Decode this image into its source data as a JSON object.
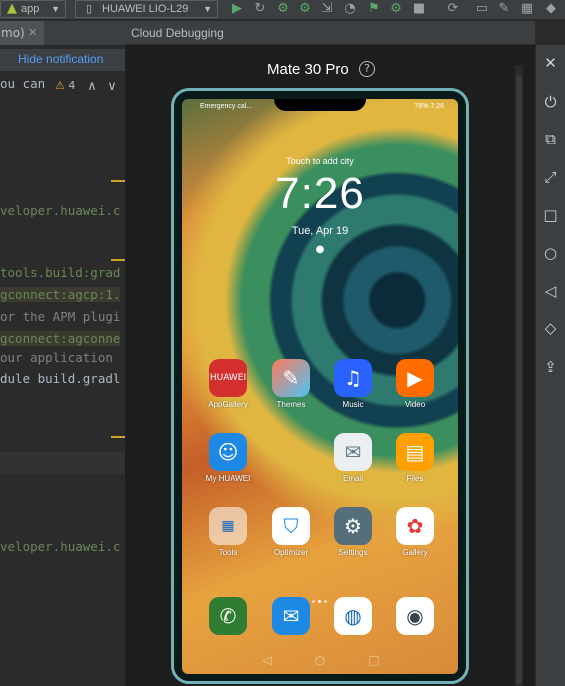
{
  "toolbar": {
    "run_config": "app",
    "device": "HUAWEI LIO-L29"
  },
  "editor": {
    "tab_label": "mo)",
    "notification_link": "Hide notification",
    "warning_count": "4",
    "lines": [
      "ou can",
      "veloper.huawei.c",
      "tools.build:grad",
      "gconnect:agcp:1.",
      "or the APM plugi",
      "gconnect:agconne",
      "our application",
      "dule build.gradl",
      "veloper.huawei.c"
    ]
  },
  "debug": {
    "title": "Cloud Debugging",
    "device_name": "Mate 30 Pro",
    "help_symbol": "?"
  },
  "phone": {
    "status_left": "Emergency cal...",
    "status_right": "78%  7:26",
    "city": "Touch to add city",
    "time": "7:26",
    "date": "Tue, Apr 19",
    "apps": [
      {
        "label": "AppGallery"
      },
      {
        "label": "Themes"
      },
      {
        "label": "Music"
      },
      {
        "label": "Video"
      },
      {
        "label": "My HUAWEI"
      },
      {
        "label": "Email"
      },
      {
        "label": "Files"
      },
      {
        "label": "Tools"
      },
      {
        "label": "Optimizer"
      },
      {
        "label": "Settings"
      },
      {
        "label": "Gallery"
      }
    ]
  },
  "colors": {
    "accent": "#589df6",
    "phone_frame": "#6fb3b8"
  }
}
